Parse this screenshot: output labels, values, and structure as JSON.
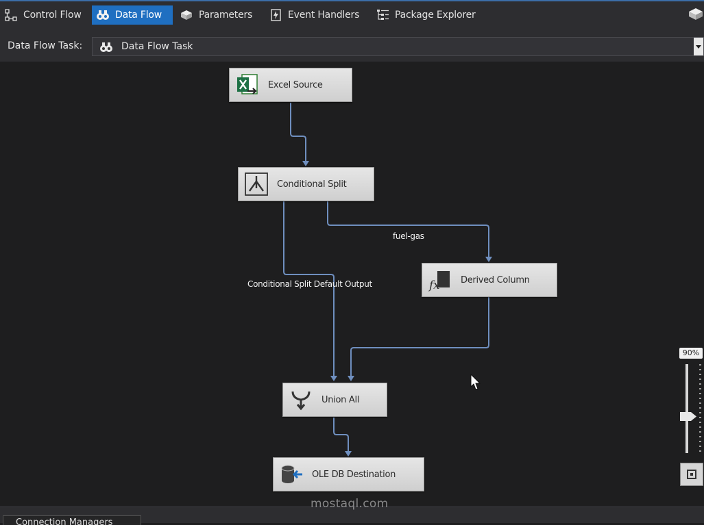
{
  "tabs": [
    {
      "label": "Control Flow",
      "icon": "control-flow-icon",
      "active": false
    },
    {
      "label": "Data Flow",
      "icon": "data-flow-icon",
      "active": true
    },
    {
      "label": "Parameters",
      "icon": "parameters-icon",
      "active": false
    },
    {
      "label": "Event Handlers",
      "icon": "event-handlers-icon",
      "active": false
    },
    {
      "label": "Package Explorer",
      "icon": "package-explorer-icon",
      "active": false
    }
  ],
  "task_selector": {
    "label": "Data Flow Task:",
    "value": "Data Flow Task",
    "icon": "data-flow-task-icon"
  },
  "components": [
    {
      "id": "excel-source",
      "label": "Excel Source",
      "icon": "excel-icon"
    },
    {
      "id": "conditional-split",
      "label": "Conditional Split",
      "icon": "split-icon"
    },
    {
      "id": "derived-column",
      "label": "Derived Column",
      "icon": "fx-icon"
    },
    {
      "id": "union-all",
      "label": "Union All",
      "icon": "union-icon"
    },
    {
      "id": "ole-db-destination",
      "label": "OLE DB Destination",
      "icon": "database-icon"
    }
  ],
  "flows": [
    {
      "from": "excel-source",
      "to": "conditional-split",
      "label": ""
    },
    {
      "from": "conditional-split",
      "to": "derived-column",
      "label": "fuel-gas"
    },
    {
      "from": "conditional-split",
      "to": "union-all",
      "label": "Conditional Split Default Output"
    },
    {
      "from": "derived-column",
      "to": "union-all",
      "label": ""
    },
    {
      "from": "union-all",
      "to": "ole-db-destination",
      "label": ""
    }
  ],
  "zoom": {
    "label": "90%",
    "value": 90
  },
  "bottom": {
    "connection_managers_label": "Connection Managers"
  },
  "watermark": "mostaql.com",
  "colors": {
    "accent": "#1f6fc1",
    "flow_line": "#6f8fbf",
    "canvas": "#1e1e1f",
    "component": "#dcdcdc"
  }
}
